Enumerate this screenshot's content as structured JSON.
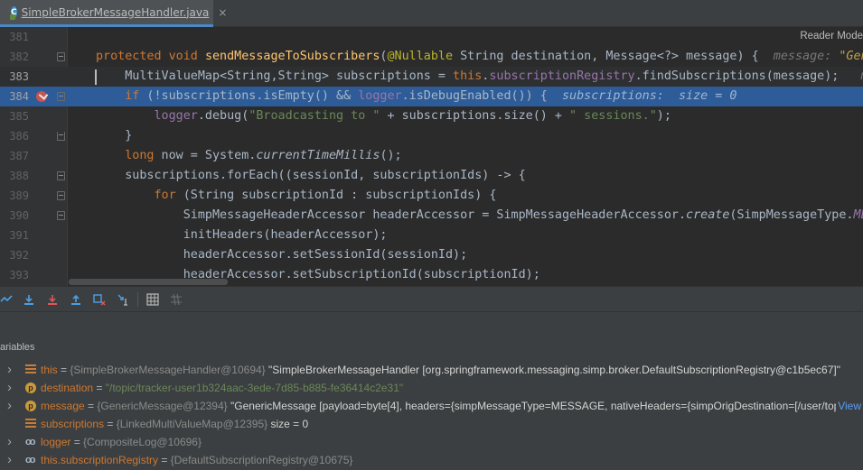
{
  "tab": {
    "filename": "SimpleBrokerMessageHandler.java",
    "icon_letter": "C",
    "close": "×"
  },
  "reader_mode": "Reader Mode",
  "code": [
    {
      "n": "381"
    },
    {
      "n": "382",
      "parts": [
        [
          "kw",
          "protected void "
        ],
        [
          "fn",
          "sendMessageToSubscribers"
        ],
        [
          "",
          "("
        ],
        [
          "ann",
          "@Nullable"
        ],
        [
          "",
          " String destination, Message<?> message) {  "
        ],
        [
          "inlay",
          "message: "
        ],
        [
          "inlay-str",
          "\"Gen"
        ]
      ]
    },
    {
      "n": "383",
      "parts": [
        [
          "",
          "    MultiValueMap<String,String> subscriptions = "
        ],
        [
          "kw",
          "this"
        ],
        [
          "",
          "."
        ],
        [
          "fld",
          "subscriptionRegistry"
        ],
        [
          "",
          ".findSubscriptions(message);   "
        ],
        [
          "inlay",
          "me"
        ]
      ]
    },
    {
      "n": "384",
      "parts": [
        [
          "",
          "    "
        ],
        [
          "kw",
          "if"
        ],
        [
          "",
          " (!subscriptions.isEmpty() && "
        ],
        [
          "fld",
          "logger"
        ],
        [
          "",
          ".isDebugEnabled()) {  "
        ],
        [
          "inlay",
          "subscriptions:  size = 0"
        ]
      ]
    },
    {
      "n": "385",
      "parts": [
        [
          "",
          "        "
        ],
        [
          "fld",
          "logger"
        ],
        [
          "",
          ".debug("
        ],
        [
          "str",
          "\"Broadcasting to \""
        ],
        [
          "",
          " + subscriptions.size() + "
        ],
        [
          "str",
          "\" sessions.\""
        ],
        [
          "",
          ");"
        ]
      ]
    },
    {
      "n": "386",
      "parts": [
        [
          "",
          "    }"
        ]
      ]
    },
    {
      "n": "387",
      "parts": [
        [
          "",
          "    "
        ],
        [
          "kw",
          "long"
        ],
        [
          "",
          " now = System."
        ],
        [
          "it",
          "currentTimeMillis"
        ],
        [
          "",
          "();"
        ]
      ]
    },
    {
      "n": "388",
      "parts": [
        [
          "",
          "    subscriptions.forEach((sessionId, subscriptionIds) -> {"
        ]
      ]
    },
    {
      "n": "389",
      "parts": [
        [
          "",
          "        "
        ],
        [
          "kw",
          "for"
        ],
        [
          "",
          " (String subscriptionId : subscriptionIds) {"
        ]
      ]
    },
    {
      "n": "390",
      "parts": [
        [
          "",
          "            SimpMessageHeaderAccessor headerAccessor = SimpMessageHeaderAccessor."
        ],
        [
          "it",
          "create"
        ],
        [
          "",
          "(SimpMessageType."
        ],
        [
          "fld it",
          "ME"
        ]
      ]
    },
    {
      "n": "391",
      "parts": [
        [
          "",
          "            initHeaders(headerAccessor);"
        ]
      ]
    },
    {
      "n": "392",
      "parts": [
        [
          "",
          "            headerAccessor.setSessionId(sessionId);"
        ]
      ]
    },
    {
      "n": "393",
      "parts": [
        [
          "",
          "            headerAccessor.setSubscriptionId(subscriptionId);"
        ]
      ]
    }
  ],
  "variables": {
    "title": "ariables",
    "rows": [
      {
        "name": "this",
        "eq": " = ",
        "type": "{SimpleBrokerMessageHandler@10694} ",
        "value": "\"SimpleBrokerMessageHandler [org.springframework.messaging.simp.broker.DefaultSubscriptionRegistry@c1b5ec67]\"",
        "value_is_string": false,
        "icon": "field",
        "expandable": true
      },
      {
        "name": "destination",
        "eq": " = ",
        "type": "",
        "value": "\"/topic/tracker-user1b324aac-3ede-7d85-b885-fe36414c2e31\"",
        "value_is_string": true,
        "icon": "param",
        "expandable": true
      },
      {
        "name": "message",
        "eq": " = ",
        "type": "{GenericMessage@12394} ",
        "value": "\"GenericMessage [payload=byte[4], headers={simpMessageType=MESSAGE, nativeHeaders={simpOrigDestination=[/user/topic...",
        "value_is_string": false,
        "icon": "param",
        "expandable": true,
        "link": "View"
      },
      {
        "name": "subscriptions",
        "eq": " = ",
        "type": "{LinkedMultiValueMap@12395} ",
        "value": " size = 0",
        "value_is_string": false,
        "icon": "field",
        "expandable": false
      },
      {
        "name": "logger",
        "eq": " = ",
        "type": "{CompositeLog@10696}",
        "value": "",
        "value_is_string": false,
        "icon": "oo",
        "expandable": true
      },
      {
        "name": "this.subscriptionRegistry",
        "eq": " = ",
        "type": "{DefaultSubscriptionRegistry@10675}",
        "value": "",
        "value_is_string": false,
        "icon": "oo",
        "expandable": true
      }
    ]
  },
  "toolbar_icons": [
    "show-execution-point-icon",
    "step-over-icon",
    "step-into-icon",
    "force-step-into-icon",
    "step-out-icon",
    "drop-frame-icon",
    "run-to-cursor-icon",
    "evaluate-expression-icon",
    "trace-current-stream-icon"
  ],
  "colors": {
    "accent": "#4a88c7",
    "highlight_line": "#2d5c98",
    "breakpoint": "#c75450"
  }
}
